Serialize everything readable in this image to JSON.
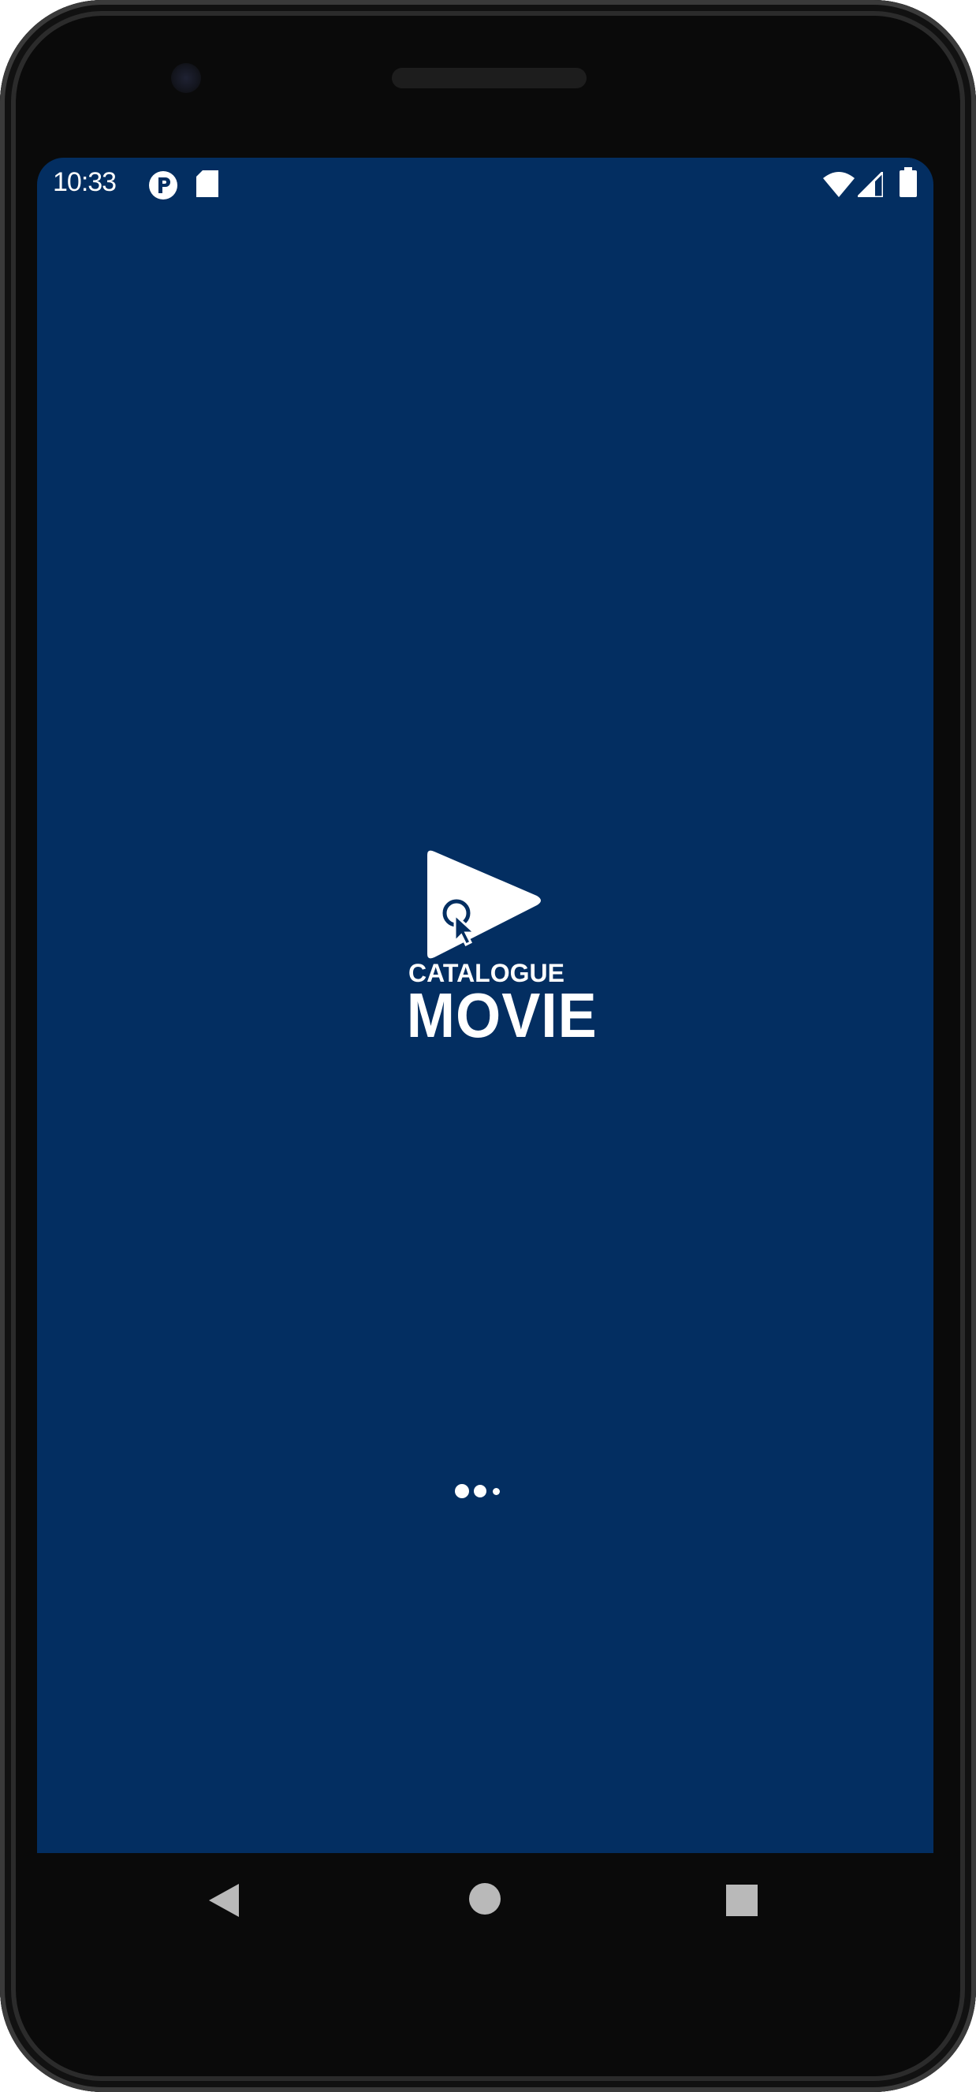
{
  "status_bar": {
    "time": "10:33",
    "icons": [
      "p-notification-icon",
      "sd-card-icon",
      "wifi-icon",
      "cell-signal-icon",
      "battery-icon"
    ]
  },
  "splash": {
    "logo_small_text": "CATALOGUE",
    "logo_big_text": "MOVIE",
    "background_color": "#032e61",
    "loading_indicator": "three-dot-loader"
  },
  "nav_bar": {
    "buttons": [
      "back-button",
      "home-button",
      "recents-button"
    ]
  }
}
